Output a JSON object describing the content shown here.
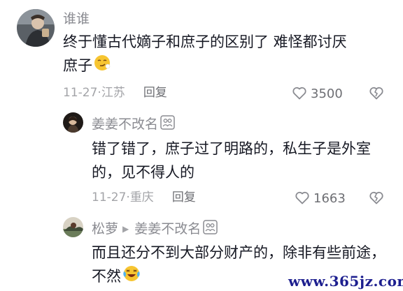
{
  "comments": [
    {
      "username": "谁谁",
      "text": "终于懂古代嫡子和庶子的区别了 难怪都讨厌庶子",
      "emoji": "smirk-emoji",
      "date": "11-27",
      "location": "江苏",
      "reply_label": "回复",
      "likes": "3500"
    },
    {
      "username": "姜姜不改名",
      "badge": "friends-badge-icon",
      "text": "错了错了，庶子过了明路的，私生子是外室的，见不得人的",
      "date": "11-27",
      "location": "重庆",
      "reply_label": "回复",
      "likes": "1663"
    },
    {
      "username": "松萝",
      "reply_to": "姜姜不改名",
      "badge": "friends-badge-icon",
      "text": "而且还分不到大部分财产的，除非有些前途，不然",
      "emoji": "crying-laughing-emoji"
    }
  ],
  "meta_separator": "·",
  "watermark": "www.365jz.com",
  "colors": {
    "text": "#161823",
    "muted": "#a3a4a8",
    "icon": "#8a8b91"
  }
}
